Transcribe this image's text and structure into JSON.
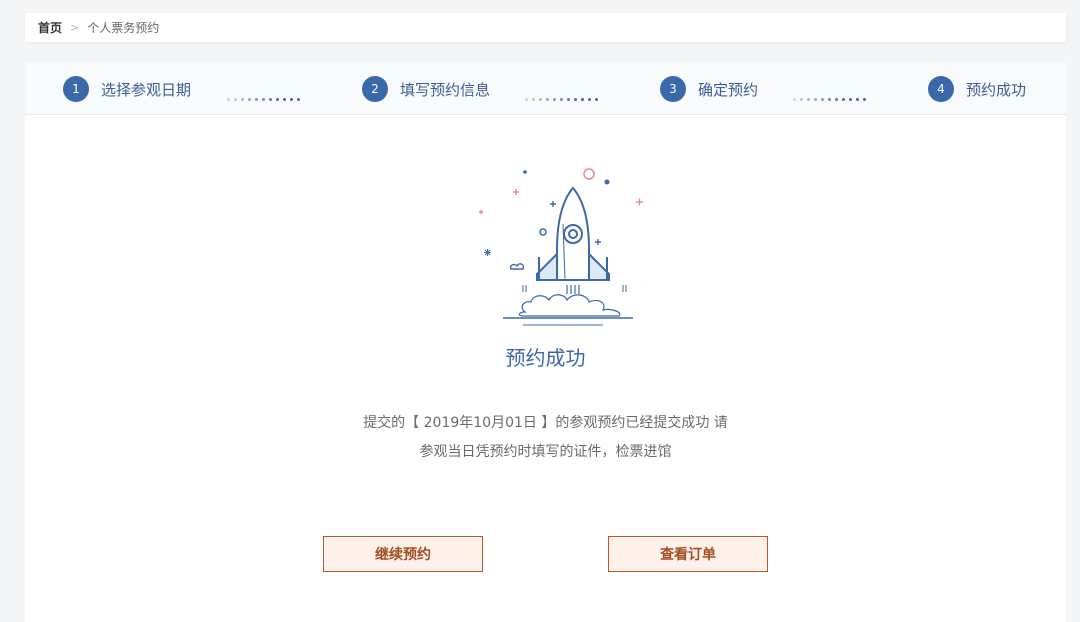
{
  "breadcrumb": {
    "home": "首页",
    "separator": ">",
    "current": "个人票务预约"
  },
  "steps": [
    {
      "num": "1",
      "label": "选择参观日期"
    },
    {
      "num": "2",
      "label": "填写预约信息"
    },
    {
      "num": "3",
      "label": "确定预约"
    },
    {
      "num": "4",
      "label": "预约成功"
    }
  ],
  "result": {
    "title": "预约成功",
    "line1": "提交的【 2019年10月01日 】的参观预约已经提交成功 请",
    "line2": "参观当日凭预约时填写的证件，检票进馆"
  },
  "buttons": {
    "continue": "继续预约",
    "view_order": "查看订单"
  },
  "colors": {
    "primary": "#3b68a9",
    "accent": "#b35a2e",
    "button_bg": "#fdf1e9"
  }
}
